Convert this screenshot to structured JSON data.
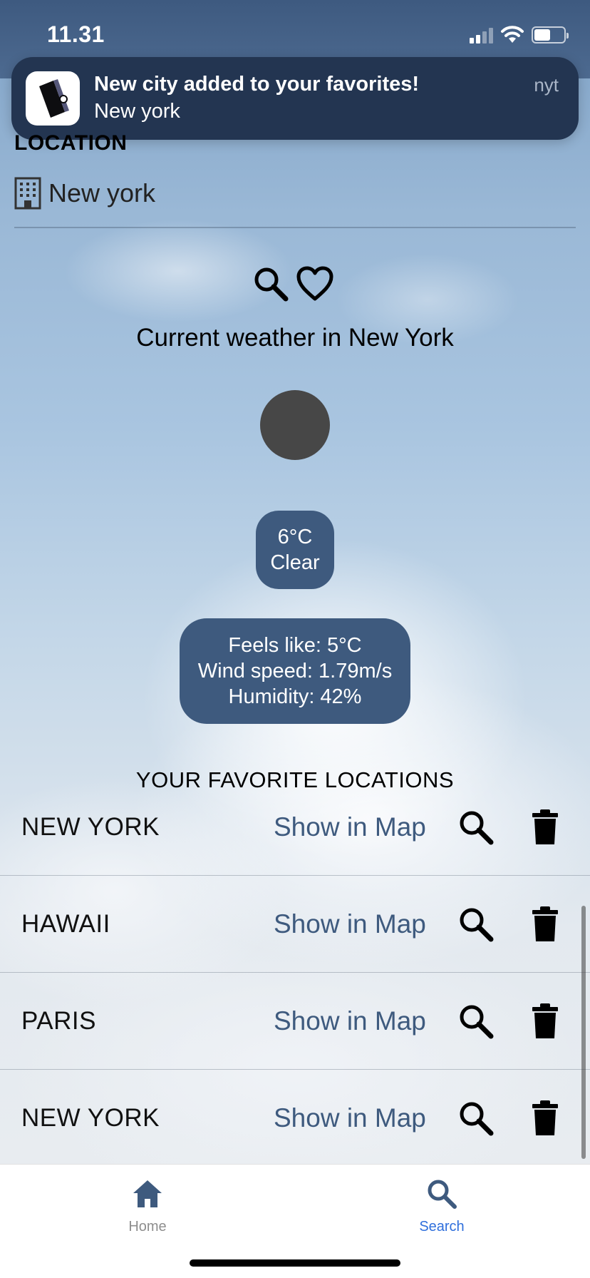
{
  "status_bar": {
    "time": "11.31",
    "battery_fill": 0.55
  },
  "notification": {
    "title": "New city added to your favorites!",
    "body": "New york",
    "time": "nyt",
    "app_icon": "app-logo-icon"
  },
  "location": {
    "label": "LOCATION",
    "value": "New york",
    "icon": "building-icon"
  },
  "actions": {
    "search_icon": "search-icon",
    "favorite_icon": "heart-icon"
  },
  "weather": {
    "heading": "Current weather in New York",
    "temperature": "6°C",
    "condition": "Clear",
    "feels_like": "Feels like: 5°C",
    "wind_speed": "Wind speed: 1.79m/s",
    "humidity": "Humidity: 42%"
  },
  "favorites": {
    "heading": "YOUR FAVORITE LOCATIONS",
    "items": [
      {
        "city": "NEW YORK",
        "map_label": "Show in Map"
      },
      {
        "city": "HAWAII",
        "map_label": "Show in Map"
      },
      {
        "city": "PARIS",
        "map_label": "Show in Map"
      },
      {
        "city": "NEW YORK",
        "map_label": "Show in Map"
      }
    ]
  },
  "tabbar": {
    "items": [
      {
        "label": "Home",
        "icon": "home-icon",
        "active": false
      },
      {
        "label": "Search",
        "icon": "search-icon",
        "active": true
      }
    ]
  },
  "colors": {
    "accent": "#3e5a7e",
    "active_tab": "#2f6fdc",
    "banner": "#233551"
  }
}
